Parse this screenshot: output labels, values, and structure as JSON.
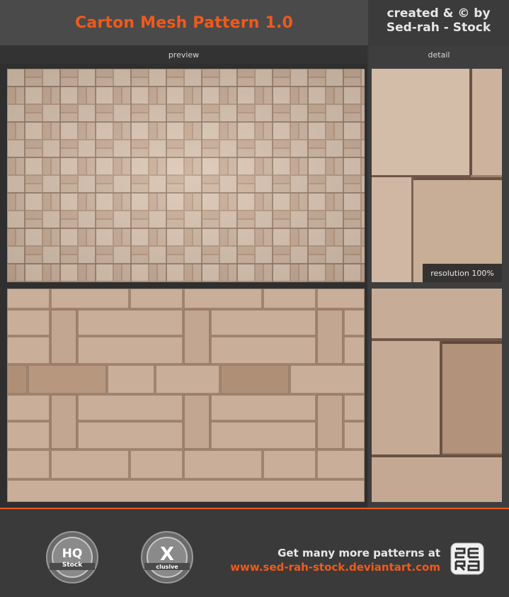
{
  "header": {
    "title": "Carton Mesh Pattern 1.0",
    "credit_line1": "created & © by",
    "credit_line2": "Sed-rah - Stock"
  },
  "labels": {
    "preview": "preview",
    "detail": "detail"
  },
  "detail": {
    "resolution": "resolution 100%"
  },
  "footer": {
    "promo_line": "Get many more patterns at",
    "promo_url": "www.sed-rah-stock.deviantart.com"
  },
  "colors": {
    "accent": "#ef5a1c",
    "cardboard_light": "#d8c0ad",
    "cardboard_mid": "#c4a88f",
    "cardboard_dark": "#a0836c"
  }
}
